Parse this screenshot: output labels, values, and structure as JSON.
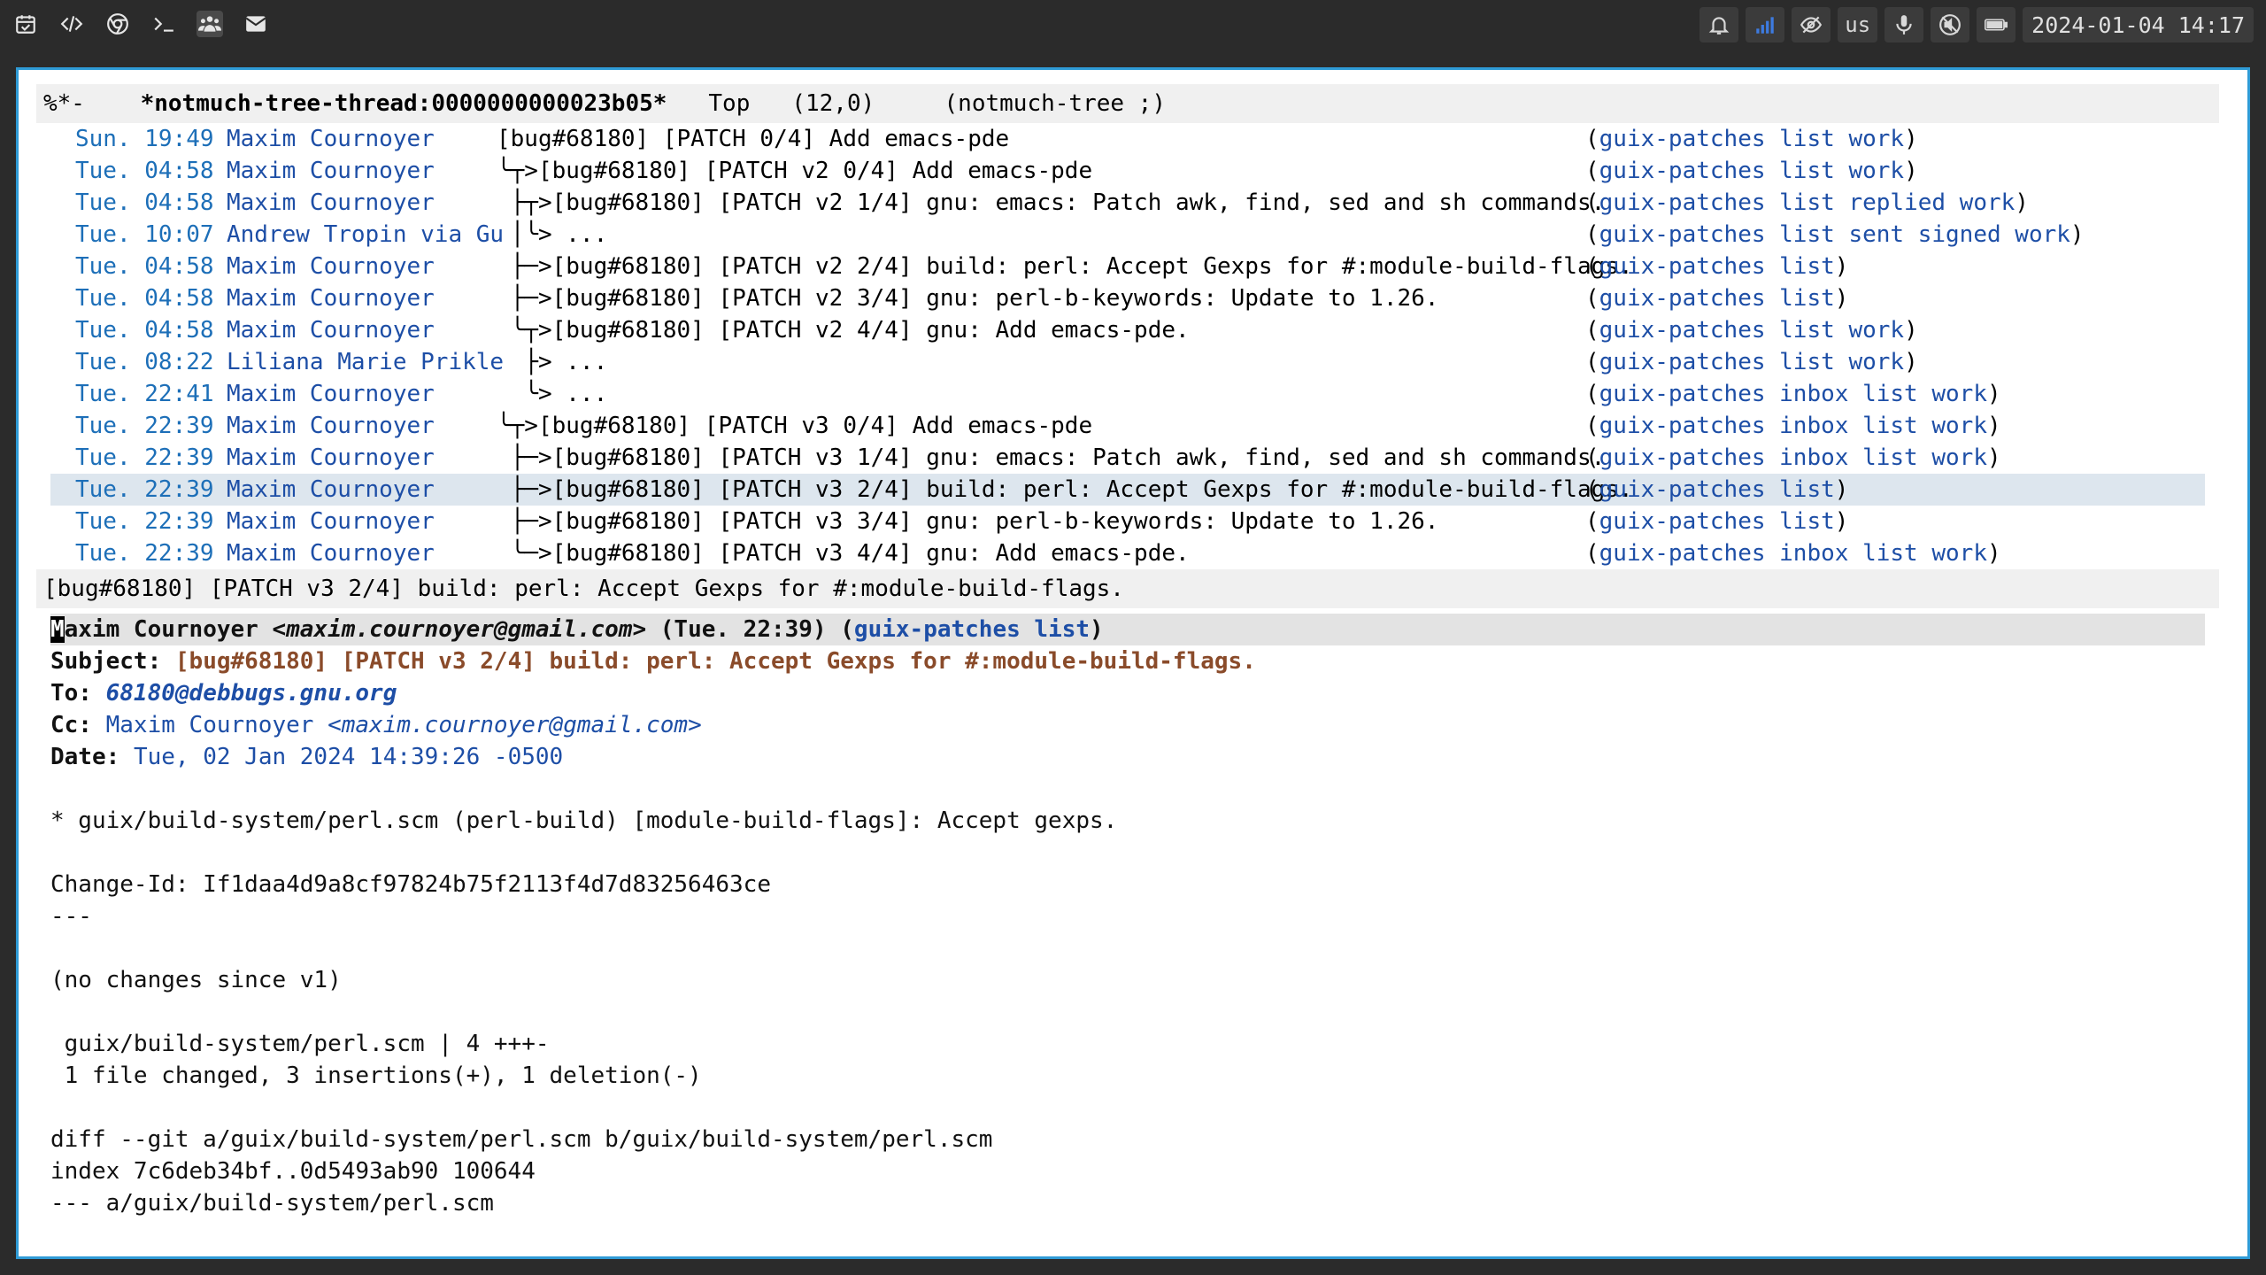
{
  "topbar": {
    "left_icons": [
      "calendar-icon",
      "code-icon",
      "chrome-icon",
      "terminal-icon",
      "people-icon",
      "mail-icon"
    ],
    "right": {
      "keyboard_layout": "us",
      "clock": "2024-01-04 14:17"
    }
  },
  "modeline_top": {
    "status": "%*-",
    "buffer": "*notmuch-tree-thread:0000000000023b05*",
    "position": "Top",
    "line_col": "(12,0)",
    "mode": "(notmuch-tree ;)"
  },
  "tree_rows": [
    {
      "date": "Sun. 19:49",
      "author": "Maxim Cournoyer",
      "subject": "[bug#68180] [PATCH 0/4] Add emacs-pde",
      "tags": [
        "guix-patches",
        "list",
        "work"
      ]
    },
    {
      "date": "Tue. 04:58",
      "author": "Maxim Cournoyer",
      "subject": "╰┬>[bug#68180] [PATCH v2 0/4] Add emacs-pde",
      "tags": [
        "guix-patches",
        "list",
        "work"
      ]
    },
    {
      "date": "Tue. 04:58",
      "author": "Maxim Cournoyer",
      "subject": " ├┬>[bug#68180] [PATCH v2 1/4] gnu: emacs: Patch awk, find, sed and sh commands.",
      "tags": [
        "guix-patches",
        "list",
        "replied",
        "work"
      ]
    },
    {
      "date": "Tue. 10:07",
      "author": "Andrew Tropin via Gu",
      "subject": " │╰> ...",
      "tags": [
        "guix-patches",
        "list",
        "sent",
        "signed",
        "work"
      ]
    },
    {
      "date": "Tue. 04:58",
      "author": "Maxim Cournoyer",
      "subject": " ├─>[bug#68180] [PATCH v2 2/4] build: perl: Accept Gexps for #:module-build-flags.",
      "tags": [
        "guix-patches",
        "list"
      ]
    },
    {
      "date": "Tue. 04:58",
      "author": "Maxim Cournoyer",
      "subject": " ├─>[bug#68180] [PATCH v2 3/4] gnu: perl-b-keywords: Update to 1.26.",
      "tags": [
        "guix-patches",
        "list"
      ]
    },
    {
      "date": "Tue. 04:58",
      "author": "Maxim Cournoyer",
      "subject": " ╰┬>[bug#68180] [PATCH v2 4/4] gnu: Add emacs-pde.",
      "tags": [
        "guix-patches",
        "list",
        "work"
      ]
    },
    {
      "date": "Tue. 08:22",
      "author": "Liliana Marie Prikle",
      "subject": "  ├> ...",
      "tags": [
        "guix-patches",
        "list",
        "work"
      ]
    },
    {
      "date": "Tue. 22:41",
      "author": "Maxim Cournoyer",
      "subject": "  ╰> ...",
      "tags": [
        "guix-patches",
        "inbox",
        "list",
        "work"
      ]
    },
    {
      "date": "Tue. 22:39",
      "author": "Maxim Cournoyer",
      "subject": "╰┬>[bug#68180] [PATCH v3 0/4] Add emacs-pde",
      "tags": [
        "guix-patches",
        "inbox",
        "list",
        "work"
      ]
    },
    {
      "date": "Tue. 22:39",
      "author": "Maxim Cournoyer",
      "subject": " ├─>[bug#68180] [PATCH v3 1/4] gnu: emacs: Patch awk, find, sed and sh commands.",
      "tags": [
        "guix-patches",
        "inbox",
        "list",
        "work"
      ]
    },
    {
      "date": "Tue. 22:39",
      "author": "Maxim Cournoyer",
      "subject": " ├─>[bug#68180] [PATCH v3 2/4] build: perl: Accept Gexps for #:module-build-flags.",
      "tags": [
        "guix-patches",
        "list"
      ],
      "selected": true
    },
    {
      "date": "Tue. 22:39",
      "author": "Maxim Cournoyer",
      "subject": " ├─>[bug#68180] [PATCH v3 3/4] gnu: perl-b-keywords: Update to 1.26.",
      "tags": [
        "guix-patches",
        "list"
      ]
    },
    {
      "date": "Tue. 22:39",
      "author": "Maxim Cournoyer",
      "subject": " ╰─>[bug#68180] [PATCH v3 4/4] gnu: Add emacs-pde.",
      "tags": [
        "guix-patches",
        "inbox",
        "list",
        "work"
      ]
    }
  ],
  "modeline_mid": "[bug#68180] [PATCH v3 2/4] build: perl: Accept Gexps for #:module-build-flags.",
  "message": {
    "header_from_name": "Maxim Cournoyer",
    "header_from_email": "<maxim.cournoyer@gmail.com>",
    "header_date": "(Tue. 22:39)",
    "header_tags": "guix-patches list",
    "subject_label": "Subject:",
    "subject": "[bug#68180] [PATCH v3 2/4] build: perl: Accept Gexps for #:module-build-flags.",
    "to_label": "To:",
    "to": "68180@debbugs.gnu.org",
    "cc_label": "Cc:",
    "cc_name": "Maxim Cournoyer",
    "cc_email": "<maxim.cournoyer@gmail.com>",
    "date_label": "Date:",
    "date": "Tue, 02 Jan 2024 14:39:26 -0500",
    "body": [
      "",
      "* guix/build-system/perl.scm (perl-build) [module-build-flags]: Accept gexps.",
      "",
      "Change-Id: If1daa4d9a8cf97824b75f2113f4d7d83256463ce",
      "---",
      "",
      "(no changes since v1)",
      "",
      " guix/build-system/perl.scm | 4 +++-",
      " 1 file changed, 3 insertions(+), 1 deletion(-)",
      "",
      "diff --git a/guix/build-system/perl.scm b/guix/build-system/perl.scm",
      "index 7c6deb34bf..0d5493ab90 100644",
      "--- a/guix/build-system/perl.scm"
    ]
  }
}
